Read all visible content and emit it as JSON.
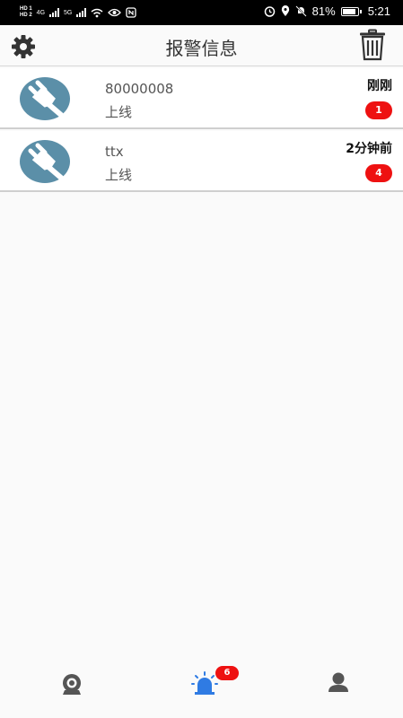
{
  "status_bar": {
    "hd1": "HD 1",
    "hd2": "HD 2",
    "net1": "4G",
    "net2": "5G",
    "battery": "81%",
    "time": "5:21"
  },
  "header": {
    "title": "报警信息"
  },
  "alerts": [
    {
      "name": "80000008",
      "status": "上线",
      "time": "刚刚",
      "count": "1"
    },
    {
      "name": "ttx",
      "status": "上线",
      "time": "2分钟前",
      "count": "4"
    }
  ],
  "bottom_nav": {
    "alarm_badge": "6"
  },
  "colors": {
    "avatar_bg": "#5b8fa8",
    "badge_red": "#ee1111",
    "active_tab": "#2f7be3",
    "inactive_tab": "#555555"
  },
  "icons": {
    "settings": "gear-icon",
    "delete": "trash-icon",
    "device": "plug-icon",
    "camera": "camera-icon",
    "alarm": "alarm-light-icon",
    "user": "user-icon"
  }
}
